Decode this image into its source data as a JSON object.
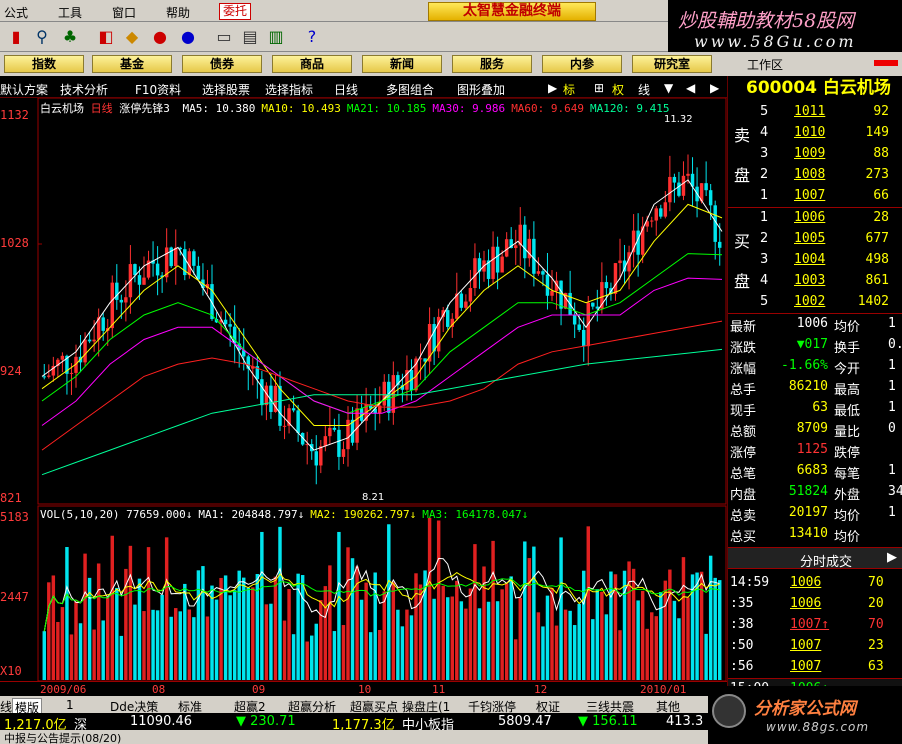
{
  "menubar": {
    "items": [
      "公式",
      "工具",
      "窗口",
      "帮助"
    ],
    "trade_btn": "委托",
    "app_title": "太智慧金融终端"
  },
  "ad": {
    "line1": "炒股輔助教材58股网",
    "line2": "www.58Gu.com",
    "logo2_cn": "分析家公式网",
    "logo2_url": "www.88gs.com"
  },
  "nav": {
    "buttons": [
      "指数",
      "基金",
      "债券",
      "商品",
      "新闻",
      "服务",
      "内参",
      "研究室"
    ],
    "workspace": "工作区"
  },
  "chart_toolbar": {
    "items": [
      "默认方案",
      "技术分析",
      "F10资料",
      "选择股票",
      "选择指标",
      "日线",
      "多图组合",
      "图形叠加",
      "标",
      "权",
      "线"
    ]
  },
  "chart": {
    "stock_name": "白云机场",
    "period": "日线",
    "indicator": "涨停先锋3",
    "ma_text": [
      {
        "label": "MA5: 10.380",
        "color": "#ffffff"
      },
      {
        "label": "MA10: 10.493",
        "color": "#ffff00"
      },
      {
        "label": "MA21: 10.185",
        "color": "#00ff00"
      },
      {
        "label": "MA30: 9.986",
        "color": "#ff00ff"
      },
      {
        "label": "MA60: 9.649",
        "color": "#ff3030"
      },
      {
        "label": "MA120: 9.415",
        "color": "#00ff99"
      }
    ],
    "price_labels": [
      "1132",
      "1028",
      "924",
      "821"
    ],
    "high_mark": "11.32",
    "low_mark": "8.21",
    "vol_text": [
      {
        "label": "VOL(5,10,20) 77659.000↓",
        "color": "#ffffff"
      },
      {
        "label": "MA1: 204848.797↓",
        "color": "#ffffff"
      },
      {
        "label": "MA2: 190262.797↓",
        "color": "#ffff00"
      },
      {
        "label": "MA3: 164178.047↓",
        "color": "#00ff00"
      }
    ],
    "vol_labels": [
      "5183",
      "2447",
      "X10"
    ],
    "x_labels": [
      "2009/06",
      "08",
      "09",
      "10",
      "11",
      "12",
      "2010/01"
    ]
  },
  "right_panel": {
    "code": "600004",
    "name": "白云机场",
    "sell_label": [
      "卖",
      "盘"
    ],
    "buy_label": [
      "买",
      "盘"
    ],
    "sell": [
      [
        "5",
        "1011",
        "92"
      ],
      [
        "4",
        "1010",
        "149"
      ],
      [
        "3",
        "1009",
        "88"
      ],
      [
        "2",
        "1008",
        "273"
      ],
      [
        "1",
        "1007",
        "66"
      ]
    ],
    "buy": [
      [
        "1",
        "1006",
        "28"
      ],
      [
        "2",
        "1005",
        "677"
      ],
      [
        "3",
        "1004",
        "498"
      ],
      [
        "4",
        "1003",
        "861"
      ],
      [
        "5",
        "1002",
        "1402"
      ]
    ],
    "stats": [
      [
        "最新",
        "1006",
        "均价",
        "1"
      ],
      [
        "涨跌",
        "▼017",
        "换手",
        "0."
      ],
      [
        "涨幅",
        "-1.66%",
        "今开",
        "1"
      ],
      [
        "总手",
        "86210",
        "最高",
        "1"
      ],
      [
        "现手",
        "63",
        "最低",
        "1"
      ],
      [
        "总额",
        "8709",
        "量比",
        "0"
      ],
      [
        "涨停",
        "1125",
        "跌停",
        ""
      ],
      [
        "总笔",
        "6683",
        "每笔",
        "1"
      ],
      [
        "内盘",
        "51824",
        "外盘",
        "34"
      ],
      [
        "总卖",
        "20197",
        "均价",
        "1"
      ],
      [
        "总买",
        "13410",
        "均价",
        ""
      ]
    ],
    "tick_header": "分时成交",
    "ticks": [
      [
        "14:59",
        "1006",
        "70"
      ],
      [
        ":35",
        "1006",
        "20"
      ],
      [
        ":38",
        "1007↑",
        "70"
      ],
      [
        ":50",
        "1007",
        "23"
      ],
      [
        ":56",
        "1007",
        "63"
      ],
      [
        "15:00",
        "1006↓",
        ""
      ]
    ]
  },
  "tabs": {
    "items": [
      "线",
      "模版",
      "1",
      "Dde决策",
      "标准",
      "超赢2",
      "超赢分析",
      "超赢买点",
      "操盘庄(1",
      "千钧涨停",
      "权证",
      "三线共震",
      "其他"
    ]
  },
  "index_bar": {
    "left_val": "1,217.0亿",
    "sz_label": "深",
    "sz_val": "11090.46",
    "sz_chg": "▼ 230.71",
    "amt": "1,177.3亿",
    "mid_label": "中小板指",
    "mid_val": "5809.47",
    "mid_chg": "▼ 156.11",
    "last": "413.3"
  },
  "notice": {
    "text": "中报与公告提示(08/20)"
  },
  "chart_data": {
    "type": "line",
    "title": "白云机场 日线",
    "x_range": [
      "2009/06",
      "2010/01"
    ],
    "ylim": [
      8.21,
      11.32
    ],
    "series": [
      {
        "name": "MA5",
        "values": [
          9.2,
          9.4,
          9.8,
          10.1,
          10.25,
          9.8,
          9.3,
          8.9,
          8.6,
          8.7,
          9.0,
          9.3,
          9.8,
          10.1,
          10.3,
          10.0,
          9.6,
          10.0,
          10.6,
          10.8,
          10.38
        ]
      },
      {
        "name": "MA10",
        "values": [
          9.1,
          9.3,
          9.6,
          9.9,
          10.1,
          9.9,
          9.5,
          9.1,
          8.8,
          8.8,
          9.0,
          9.2,
          9.6,
          9.9,
          10.1,
          9.9,
          9.8,
          9.9,
          10.3,
          10.6,
          10.49
        ]
      },
      {
        "name": "MA21",
        "values": [
          9.0,
          9.2,
          9.5,
          9.7,
          9.8,
          9.7,
          9.4,
          9.2,
          9.0,
          8.9,
          9.0,
          9.1,
          9.4,
          9.6,
          9.8,
          9.8,
          9.7,
          9.8,
          10.0,
          10.2,
          10.19
        ]
      },
      {
        "name": "MA30",
        "values": [
          8.8,
          9.0,
          9.3,
          9.5,
          9.6,
          9.6,
          9.4,
          9.2,
          9.0,
          8.9,
          8.9,
          9.0,
          9.2,
          9.4,
          9.6,
          9.7,
          9.7,
          9.7,
          9.9,
          10.0,
          9.99
        ]
      },
      {
        "name": "MA60",
        "values": [
          8.6,
          8.8,
          9.0,
          9.2,
          9.3,
          9.35,
          9.3,
          9.2,
          9.1,
          9.0,
          8.95,
          8.95,
          9.0,
          9.1,
          9.3,
          9.4,
          9.45,
          9.5,
          9.55,
          9.6,
          9.65
        ]
      },
      {
        "name": "MA120",
        "values": [
          8.4,
          8.5,
          8.6,
          8.7,
          8.8,
          8.9,
          8.95,
          9.0,
          9.05,
          9.05,
          9.05,
          9.05,
          9.1,
          9.15,
          9.2,
          9.25,
          9.3,
          9.33,
          9.36,
          9.39,
          9.42
        ]
      }
    ]
  }
}
